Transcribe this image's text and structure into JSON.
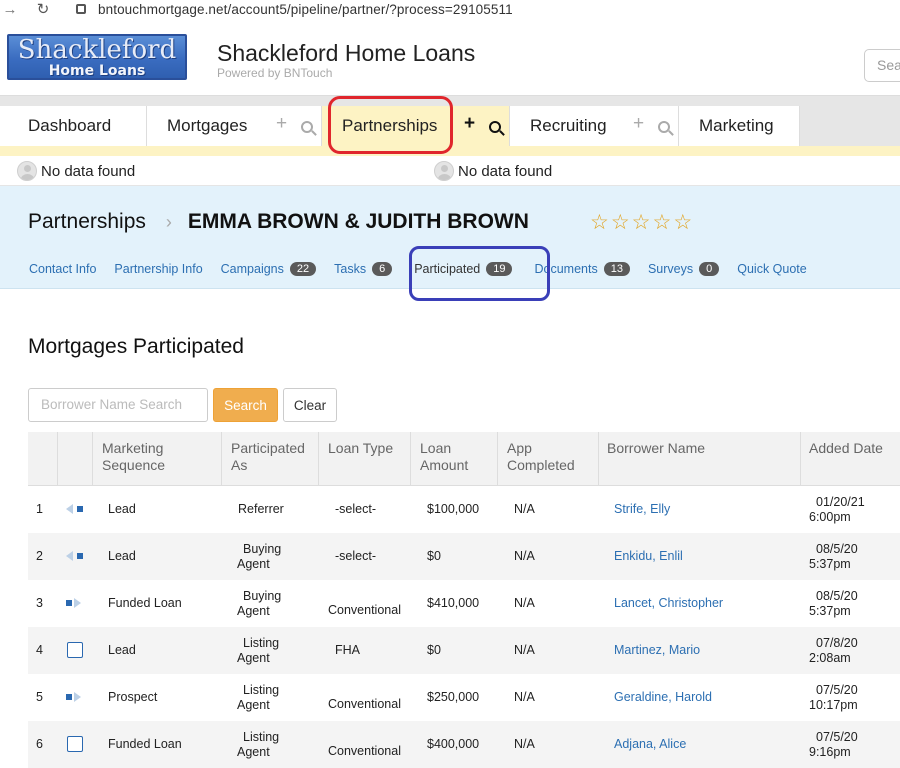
{
  "browser": {
    "url": "bntouchmortgage.net/account5/pipeline/partner/?process=29105511"
  },
  "header": {
    "logo_line1": "Shackleford",
    "logo_line2": "Home Loans",
    "title": "Shackleford Home Loans",
    "subtitle": "Powered by BNTouch",
    "search_placeholder": "Sea"
  },
  "tabs": [
    {
      "label": "Dashboard"
    },
    {
      "label": "Mortgages"
    },
    {
      "label": "Partnerships"
    },
    {
      "label": "Recruiting"
    },
    {
      "label": "Marketing"
    }
  ],
  "nodata": {
    "left": "No data found",
    "right": "No data found"
  },
  "breadcrumb": {
    "section": "Partnerships",
    "name": "EMMA BROWN & JUDITH BROWN",
    "rating": 0,
    "max_rating": 5
  },
  "subnav": [
    {
      "label": "Contact Info"
    },
    {
      "label": "Partnership Info"
    },
    {
      "label": "Campaigns",
      "count": "22"
    },
    {
      "label": "Tasks",
      "count": "6"
    },
    {
      "label": "Participated",
      "count": "19"
    },
    {
      "label": "Documents",
      "count": "13"
    },
    {
      "label": "Surveys",
      "count": "0"
    },
    {
      "label": "Quick Quote"
    }
  ],
  "section": {
    "title": "Mortgages Participated",
    "search_placeholder": "Borrower Name Search",
    "search_label": "Search",
    "clear_label": "Clear"
  },
  "table": {
    "columns": [
      {
        "l1": "Marketing",
        "l2": "Sequence"
      },
      {
        "l1": "Participated",
        "l2": "As"
      },
      {
        "l1": "Loan Type",
        "l2": ""
      },
      {
        "l1": "Loan",
        "l2": "Amount"
      },
      {
        "l1": "App",
        "l2": "Completed"
      },
      {
        "l1": "Borrower Name",
        "l2": ""
      },
      {
        "l1": "Added Date",
        "l2": ""
      }
    ],
    "rows": [
      {
        "num": "1",
        "icon": "arrow-left",
        "seq": "Lead",
        "as1": "Referrer",
        "as2": "",
        "type": "-select-",
        "amount": "$100,000",
        "app": "N/A",
        "borrower": "Strife, Elly",
        "date": "01/20/21",
        "time": "6:00pm"
      },
      {
        "num": "2",
        "icon": "arrow-left",
        "seq": "Lead",
        "as1": "Buying",
        "as2": "Agent",
        "type": "-select-",
        "amount": "$0",
        "app": "N/A",
        "borrower": "Enkidu, Enlil",
        "date": "08/5/20",
        "time": "5:37pm"
      },
      {
        "num": "3",
        "icon": "arrow-right",
        "seq": "Funded Loan",
        "as1": "Buying",
        "as2": "Agent",
        "type": "Conventional",
        "amount": "$410,000",
        "app": "N/A",
        "borrower": "Lancet, Christopher",
        "date": "08/5/20",
        "time": "5:37pm"
      },
      {
        "num": "4",
        "icon": "checkbox",
        "seq": "Lead",
        "as1": "Listing",
        "as2": "Agent",
        "type": "FHA",
        "amount": "$0",
        "app": "N/A",
        "borrower": "Martinez, Mario",
        "date": "07/8/20",
        "time": "2:08am"
      },
      {
        "num": "5",
        "icon": "arrow-right",
        "seq": "Prospect",
        "as1": "Listing",
        "as2": "Agent",
        "type": "Conventional",
        "amount": "$250,000",
        "app": "N/A",
        "borrower": "Geraldine, Harold",
        "date": "07/5/20",
        "time": "10:17pm"
      },
      {
        "num": "6",
        "icon": "checkbox",
        "seq": "Funded Loan",
        "as1": "Listing",
        "as2": "Agent",
        "type": "Conventional",
        "amount": "$400,000",
        "app": "N/A",
        "borrower": "Adjana, Alice",
        "date": "07/5/20",
        "time": "9:16pm"
      }
    ]
  }
}
